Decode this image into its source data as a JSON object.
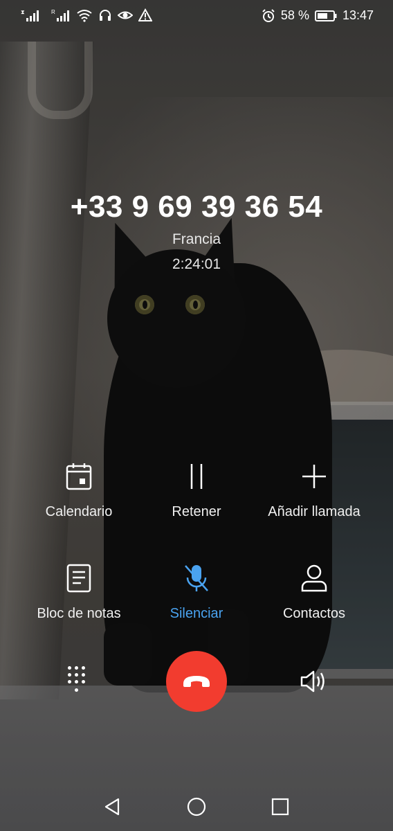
{
  "status_bar": {
    "battery_percent": "58 %",
    "time": "13:47",
    "icons": [
      "sim1-signal-icon",
      "sim2-signal-icon",
      "wifi-icon",
      "headset-icon",
      "eye-comfort-icon",
      "warning-icon",
      "alarm-icon",
      "battery-icon"
    ]
  },
  "call": {
    "number": "+33 9 69 39 36 54",
    "location": "Francia",
    "duration": "2:24:01"
  },
  "actions": {
    "calendar": "Calendario",
    "hold": "Retener",
    "add_call": "Añadir llamada",
    "notes": "Bloc de notas",
    "mute": "Silenciar",
    "contacts": "Contactos"
  },
  "controls": {
    "dialpad_icon": "dialpad-icon",
    "end_call_icon": "end-call-icon",
    "speaker_icon": "speaker-icon"
  },
  "navigation": {
    "icons": [
      "back-icon",
      "home-icon",
      "recents-icon"
    ]
  },
  "colors": {
    "end_call": "#f23c2f",
    "active_accent": "#4aa3f0"
  }
}
